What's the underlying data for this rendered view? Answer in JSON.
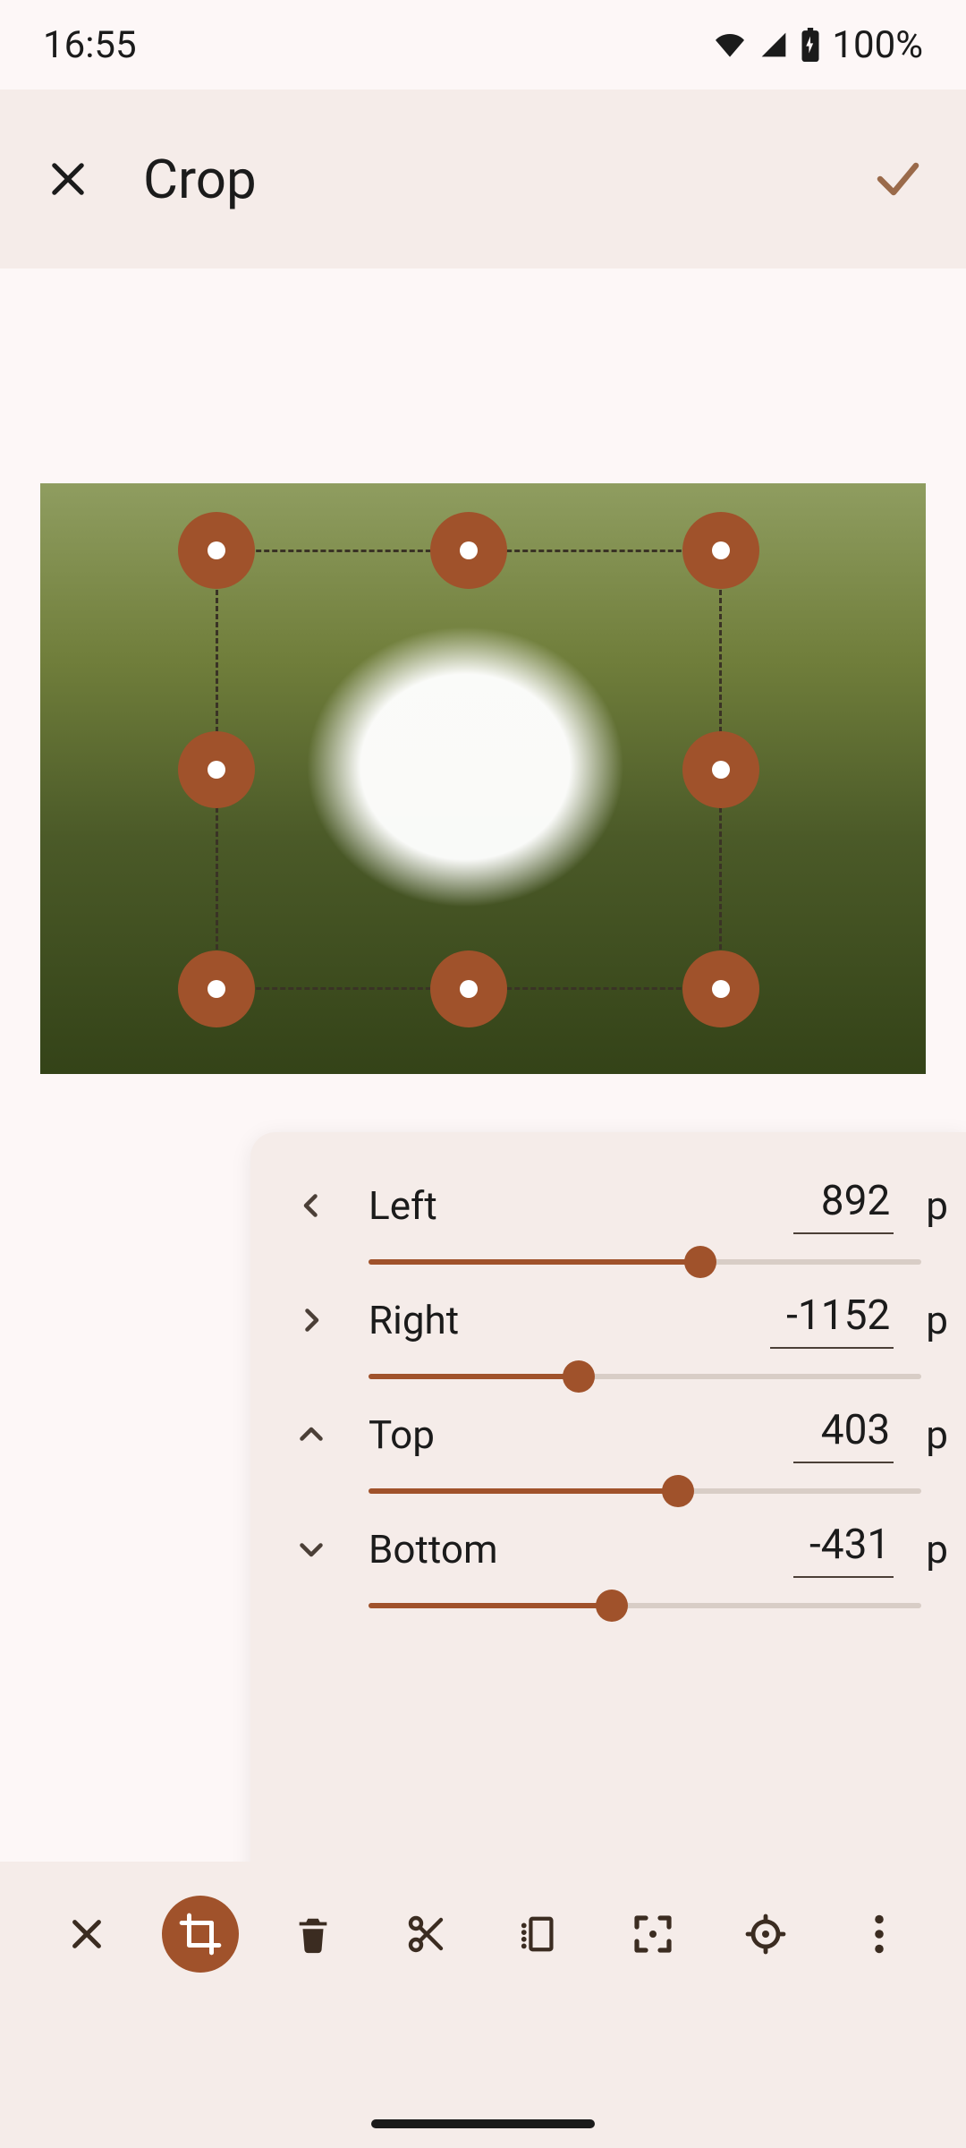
{
  "status": {
    "time": "16:55",
    "battery_label": "100%"
  },
  "header": {
    "title": "Crop"
  },
  "crop": {
    "rows": [
      {
        "key": "left",
        "label": "Left",
        "value": "892",
        "unit": "p",
        "dir": "chevron-left",
        "pct": 60
      },
      {
        "key": "right",
        "label": "Right",
        "value": "-1152",
        "unit": "p",
        "dir": "chevron-right",
        "pct": 38
      },
      {
        "key": "top",
        "label": "Top",
        "value": "403",
        "unit": "p",
        "dir": "chevron-up",
        "pct": 56
      },
      {
        "key": "bottom",
        "label": "Bottom",
        "value": "-431",
        "unit": "p",
        "dir": "chevron-down",
        "pct": 44
      }
    ]
  },
  "tools": [
    {
      "name": "close"
    },
    {
      "name": "crop"
    },
    {
      "name": "delete"
    },
    {
      "name": "cut"
    },
    {
      "name": "resize-canvas"
    },
    {
      "name": "fit"
    },
    {
      "name": "center"
    },
    {
      "name": "more"
    }
  ]
}
